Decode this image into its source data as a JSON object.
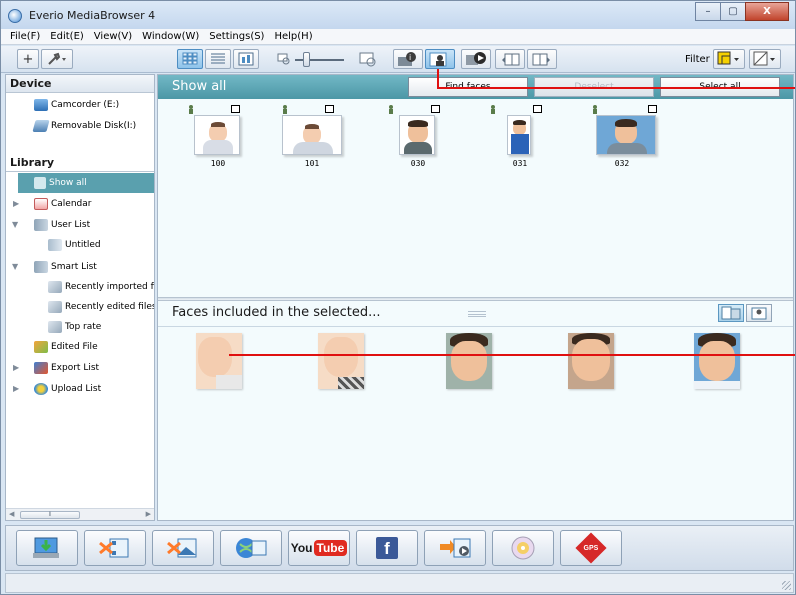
{
  "window": {
    "title": "Everio MediaBrowser 4",
    "controls": [
      "–",
      "▢",
      "X"
    ]
  },
  "menu": [
    "File(F)",
    "Edit(E)",
    "View(V)",
    "Window(W)",
    "Settings(S)",
    "Help(H)"
  ],
  "toolbar": {
    "filter_label": "Filter"
  },
  "sidebar": {
    "device_heading": "Device",
    "devices": [
      {
        "label": "Camcorder (E:)",
        "icon": "camcorder-icon"
      },
      {
        "label": "Removable Disk(I:)",
        "icon": "removable-disk-icon"
      }
    ],
    "library_heading": "Library",
    "library": [
      {
        "label": "Show all",
        "icon": "show-all-icon",
        "selected": true
      },
      {
        "label": "Calendar",
        "icon": "calendar-icon"
      },
      {
        "label": "User List",
        "icon": "user-list-icon"
      },
      {
        "label": "Untitled",
        "icon": "list-icon"
      },
      {
        "label": "Smart List",
        "icon": "smart-list-icon"
      },
      {
        "label": "Recently imported files",
        "icon": "smart-item-icon"
      },
      {
        "label": "Recently edited files",
        "icon": "smart-item-icon"
      },
      {
        "label": "Top rate",
        "icon": "smart-item-icon"
      },
      {
        "label": "Edited File",
        "icon": "edited-file-icon"
      },
      {
        "label": "Export List",
        "icon": "export-list-icon"
      },
      {
        "label": "Upload List",
        "icon": "upload-list-icon"
      }
    ]
  },
  "main": {
    "title": "Show all",
    "buttons": {
      "find_faces": "Find faces",
      "deselect": "Deselect",
      "select_all": "Select all"
    },
    "thumbnails": [
      {
        "label": "100",
        "shirt": "#d8dde6"
      },
      {
        "label": "101",
        "shirt": "#cfd6e0"
      },
      {
        "label": "030",
        "shirt": "#5b6a6e"
      },
      {
        "label": "031",
        "shirt": "#2b63b8"
      },
      {
        "label": "032",
        "shirt": "#7a8d9c"
      }
    ],
    "faces_title": "Faces included in the selected..."
  },
  "bottom_bar": [
    {
      "icon": "import-icon"
    },
    {
      "icon": "video-edit-icon"
    },
    {
      "icon": "photo-edit-icon"
    },
    {
      "icon": "web-upload-icon"
    },
    {
      "icon": "youtube-icon",
      "text_a": "You",
      "text_b": "Tube"
    },
    {
      "icon": "facebook-icon",
      "text_a": "f"
    },
    {
      "icon": "export-icon"
    },
    {
      "icon": "disc-icon"
    },
    {
      "icon": "gps-icon",
      "text_a": "GPS"
    }
  ],
  "colors": {
    "accent": "#5aa0ae",
    "pointer": "#e01010"
  }
}
